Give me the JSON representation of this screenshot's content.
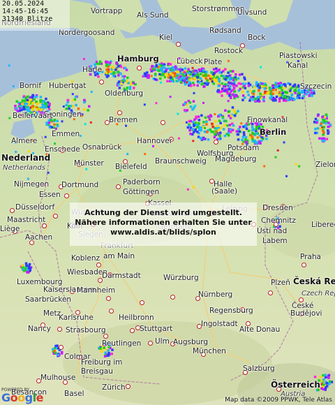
{
  "info": {
    "date": "20.05.2024",
    "time_range": "14:45-16:45",
    "strike_count": "31340 Blitze"
  },
  "notice": {
    "line1": "Achtung der Dienst wird umgestellt.",
    "line2": "Nähere informationen erhalten Sie unter",
    "line3": "www.aldis.at/blids/splon"
  },
  "attribution": "Map data ©2009 PPWK, Tele Atlas",
  "powered_by": "POWERED BY",
  "powered_logo": "Google",
  "colors": {
    "land": "#cfdfae",
    "sea": "#a7c0d9",
    "road": "#f0d080",
    "dot_border": "#b81e1e"
  },
  "cities": [
    {
      "name": "Vortrapp",
      "kind": "normal"
    },
    {
      "name": "Als Sund",
      "kind": "normal"
    },
    {
      "name": "Storstrømmen",
      "kind": "normal"
    },
    {
      "name": "Ulvsund",
      "kind": "normal"
    },
    {
      "name": "Nordfriesland",
      "kind": "normal"
    },
    {
      "name": "Nordergoosand",
      "kind": "normal"
    },
    {
      "name": "Kiel",
      "kind": "normal"
    },
    {
      "name": "Rødsand",
      "kind": "normal"
    },
    {
      "name": "Bock",
      "kind": "normal"
    },
    {
      "name": "Piastowski",
      "kind": "normal"
    },
    {
      "name": "Kanal",
      "kind": "normal"
    },
    {
      "name": "Harle",
      "kind": "normal"
    },
    {
      "name": "Lübeck",
      "kind": "normal"
    },
    {
      "name": "Rostock",
      "kind": "normal"
    },
    {
      "name": "Plate",
      "kind": "normal"
    },
    {
      "name": "Hamburg",
      "kind": "big"
    },
    {
      "name": "Hubertgat",
      "kind": "normal"
    },
    {
      "name": "Bornif",
      "kind": "normal"
    },
    {
      "name": "Oldenburg",
      "kind": "normal"
    },
    {
      "name": "Szczecin",
      "kind": "normal"
    },
    {
      "name": "Groningen",
      "kind": "normal"
    },
    {
      "name": "Beilervaart",
      "kind": "normal"
    },
    {
      "name": "Bremen",
      "kind": "normal"
    },
    {
      "name": "Finowkanal",
      "kind": "normal"
    },
    {
      "name": "Emmen",
      "kind": "normal"
    },
    {
      "name": "Berlin",
      "kind": "big"
    },
    {
      "name": "Almere",
      "kind": "normal"
    },
    {
      "name": "Hannover",
      "kind": "normal"
    },
    {
      "name": "Wolfsburg",
      "kind": "normal"
    },
    {
      "name": "Potsdam",
      "kind": "normal"
    },
    {
      "name": "Osnabrück",
      "kind": "normal"
    },
    {
      "name": "Nederland",
      "kind": "country"
    },
    {
      "name": "Enschede",
      "kind": "normal"
    },
    {
      "name": "Braunschweig",
      "kind": "normal"
    },
    {
      "name": "Magdeburg",
      "kind": "normal"
    },
    {
      "name": "Zielona",
      "kind": "normal"
    },
    {
      "name": "Netherlands",
      "kind": "it"
    },
    {
      "name": "Münster",
      "kind": "normal"
    },
    {
      "name": "Bielefeld",
      "kind": "normal"
    },
    {
      "name": "Nijmegen",
      "kind": "normal"
    },
    {
      "name": "Dortmund",
      "kind": "normal"
    },
    {
      "name": "Paderborn",
      "kind": "normal"
    },
    {
      "name": "Göttingen",
      "kind": "normal"
    },
    {
      "name": "Halle",
      "kind": "normal"
    },
    {
      "name": "(Saale)",
      "kind": "normal"
    },
    {
      "name": "Essen",
      "kind": "normal"
    },
    {
      "name": "Kassel",
      "kind": "normal"
    },
    {
      "name": "Düsseldorf",
      "kind": "normal"
    },
    {
      "name": "Leipzig",
      "kind": "grey"
    },
    {
      "name": "Dresden",
      "kind": "normal"
    },
    {
      "name": "Wuppertal",
      "kind": "grey"
    },
    {
      "name": "Deutschland",
      "kind": "grey"
    },
    {
      "name": "Maastricht",
      "kind": "normal"
    },
    {
      "name": "Köln",
      "kind": "normal"
    },
    {
      "name": "Chemnitz",
      "kind": "normal"
    },
    {
      "name": "Liberec",
      "kind": "normal"
    },
    {
      "name": "Liège",
      "kind": "normal"
    },
    {
      "name": "Siegen",
      "kind": "grey"
    },
    {
      "name": "Germany",
      "kind": "grey"
    },
    {
      "name": "Ústí nad",
      "kind": "normal"
    },
    {
      "name": "Labem",
      "kind": "normal"
    },
    {
      "name": "Aachen",
      "kind": "normal"
    },
    {
      "name": "Frankfurt",
      "kind": "grey"
    },
    {
      "name": "Koblenz",
      "kind": "normal"
    },
    {
      "name": "am Main",
      "kind": "normal"
    },
    {
      "name": "Praha",
      "kind": "normal"
    },
    {
      "name": "Wiesbaden",
      "kind": "normal"
    },
    {
      "name": "Luxembourg",
      "kind": "normal"
    },
    {
      "name": "Darmstadt",
      "kind": "normal"
    },
    {
      "name": "Würzburg",
      "kind": "normal"
    },
    {
      "name": "Plzeň",
      "kind": "normal"
    },
    {
      "name": "Česká Rep",
      "kind": "country"
    },
    {
      "name": "Kaiserslautern",
      "kind": "normal"
    },
    {
      "name": "Mannheim",
      "kind": "normal"
    },
    {
      "name": "Czech Rep",
      "kind": "it"
    },
    {
      "name": "Saarbrücken",
      "kind": "normal"
    },
    {
      "name": "Nürnberg",
      "kind": "normal"
    },
    {
      "name": "Karlsruhe",
      "kind": "normal"
    },
    {
      "name": "Heilbronn",
      "kind": "normal"
    },
    {
      "name": "Regensburg",
      "kind": "normal"
    },
    {
      "name": "Metz",
      "kind": "normal"
    },
    {
      "name": "České",
      "kind": "normal"
    },
    {
      "name": "Budějovi",
      "kind": "normal"
    },
    {
      "name": "Nancy",
      "kind": "normal"
    },
    {
      "name": "Strasbourg",
      "kind": "normal"
    },
    {
      "name": "Stuttgart",
      "kind": "normal"
    },
    {
      "name": "Ingolstadt",
      "kind": "normal"
    },
    {
      "name": "Alte Donau",
      "kind": "normal"
    },
    {
      "name": "Reutlingen",
      "kind": "normal"
    },
    {
      "name": "Ulm",
      "kind": "normal"
    },
    {
      "name": "Augsburg",
      "kind": "normal"
    },
    {
      "name": "Colmar",
      "kind": "normal"
    },
    {
      "name": "Freiburg im",
      "kind": "normal"
    },
    {
      "name": "Breisgau",
      "kind": "normal"
    },
    {
      "name": "München",
      "kind": "normal"
    },
    {
      "name": "Mulhouse",
      "kind": "normal"
    },
    {
      "name": "Salzburg",
      "kind": "normal"
    },
    {
      "name": "Besançon",
      "kind": "normal"
    },
    {
      "name": "Basel",
      "kind": "normal"
    },
    {
      "name": "Zürich",
      "kind": "normal"
    },
    {
      "name": "Österreich",
      "kind": "country"
    },
    {
      "name": "Austria",
      "kind": "it"
    }
  ]
}
